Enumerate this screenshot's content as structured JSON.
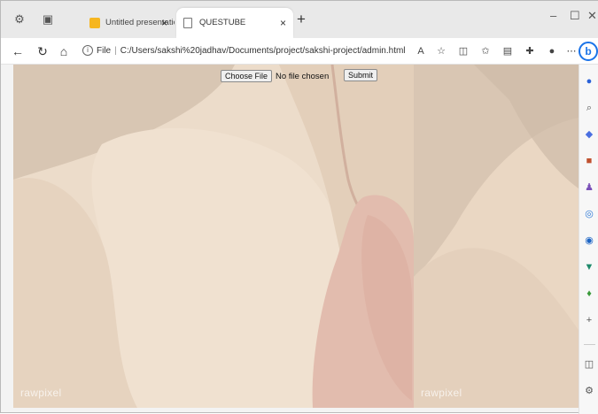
{
  "browser": {
    "tabs": [
      {
        "title": "Untitled presentation - Goo",
        "icon": "slides-icon",
        "active": false
      },
      {
        "title": "QUESTUBE",
        "icon": "page-icon",
        "active": true
      }
    ],
    "tab_close_glyph": "×",
    "new_tab_glyph": "+",
    "window_controls": {
      "minimize": "–",
      "maximize": "☐",
      "close": "✕"
    },
    "address": {
      "scheme_label": "File",
      "url": "C:/Users/sakshi%20jadhav/Documents/project/sakshi-project/admin.html"
    },
    "sidebar_icons": [
      "pin-icon",
      "search-icon",
      "tag-icon",
      "shopping-icon",
      "games-icon",
      "microsoft-365-icon",
      "outlook-icon",
      "designer-icon",
      "drop-icon",
      "add-icon",
      "split-screen-icon",
      "settings-icon"
    ]
  },
  "page": {
    "choose_file_label": "Choose File",
    "file_status": "No file chosen",
    "submit_label": "Submit",
    "watermark": "rawpixel"
  },
  "colors": {
    "background": "#ecdcca",
    "accent_link": "#1a73e8",
    "slides_yellow": "#f6b620"
  }
}
